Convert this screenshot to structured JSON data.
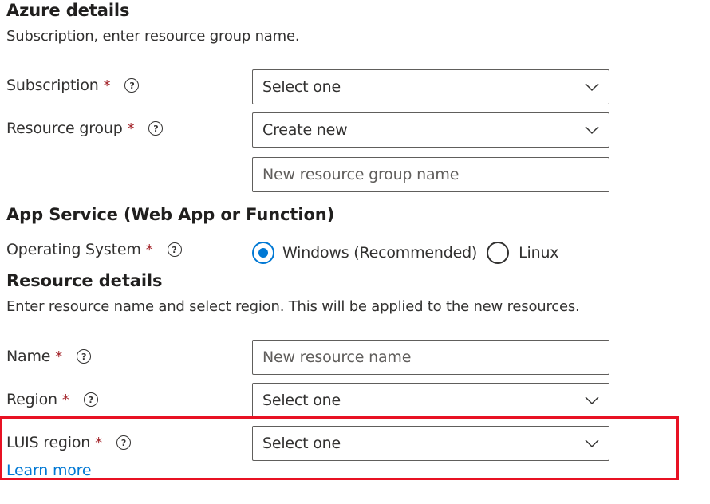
{
  "azure_details": {
    "heading": "Azure details",
    "description": "Subscription, enter resource group name.",
    "subscription": {
      "label": "Subscription",
      "required": "*",
      "value": "Select one"
    },
    "resource_group": {
      "label": "Resource group",
      "required": "*",
      "value": "Create new",
      "new_name_placeholder": "New resource group name"
    }
  },
  "app_service": {
    "heading": "App Service (Web App or Function)",
    "operating_system": {
      "label": "Operating System",
      "required": "*",
      "options": [
        {
          "label": "Windows (Recommended)",
          "selected": true
        },
        {
          "label": "Linux",
          "selected": false
        }
      ]
    }
  },
  "resource_details": {
    "heading": "Resource details",
    "description": "Enter resource name and select region. This will be applied to the new resources.",
    "name": {
      "label": "Name",
      "required": "*",
      "placeholder": "New resource name"
    },
    "region": {
      "label": "Region",
      "required": "*",
      "value": "Select one"
    },
    "luis_region": {
      "label": "LUIS region",
      "required": "*",
      "value": "Select one",
      "learn_more": "Learn more"
    }
  },
  "help_glyph": "?",
  "icons": {
    "help": "question-circle-icon",
    "dropdown": "chevron-down-icon"
  },
  "colors": {
    "accent": "#0078d4",
    "required": "#a4262c",
    "highlight": "#e81123",
    "link": "#0078d4"
  }
}
